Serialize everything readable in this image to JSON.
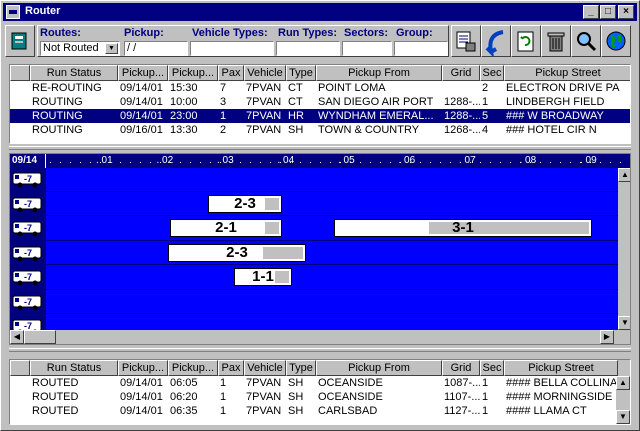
{
  "window": {
    "title": "Router"
  },
  "filters": {
    "routes_label": "Routes:",
    "routes_value": "Not Routed",
    "pickup_label": "Pickup:",
    "pickup_value": " / /",
    "vehicle_types_label": "Vehicle Types:",
    "vehicle_types_value": "",
    "run_types_label": "Run Types:",
    "run_types_value": "",
    "sectors_label": "Sectors:",
    "sectors_value": "",
    "group_label": "Group:",
    "group_value": ""
  },
  "columns": [
    "Run Status",
    "Pickup...",
    "Pickup...",
    "Pax",
    "Vehicle",
    "Type",
    "Pickup From",
    "Grid",
    "Sec",
    "Pickup Street"
  ],
  "top_grid": {
    "rows": [
      [
        "RE-ROUTING",
        "09/14/01",
        "15:30",
        "7",
        "7PVAN",
        "CT",
        "POINT LOMA",
        "",
        "2",
        "ELECTRON DRIVE PA"
      ],
      [
        "ROUTING",
        "09/14/01",
        "10:00",
        "3",
        "7PVAN",
        "CT",
        "SAN DIEGO AIR PORT",
        "1288-...",
        "1",
        "LINDBERGH FIELD"
      ],
      [
        "ROUTING",
        "09/14/01",
        "23:00",
        "1",
        "7PVAN",
        "HR",
        "WYNDHAM EMERAL...",
        "1288-...",
        "5",
        "### W BROADWAY"
      ],
      [
        "ROUTING",
        "09/16/01",
        "13:30",
        "2",
        "7PVAN",
        "SH",
        "TOWN & COUNTRY",
        "1268-...",
        "4",
        "### HOTEL CIR N"
      ]
    ],
    "selected_row": 2
  },
  "timeline": {
    "date": "09/14",
    "hours": [
      ". 01",
      ". 02",
      ". 03",
      ". 04",
      ". 05",
      ". 06",
      ". 07",
      ". 08",
      ". 09"
    ],
    "vehicle_label": "7",
    "runs": [
      {
        "label": "2-3"
      },
      {
        "label": "2-1"
      },
      {
        "label": "3-1"
      },
      {
        "label": "2-3"
      },
      {
        "label": "1-1"
      }
    ]
  },
  "bottom_grid": {
    "rows": [
      [
        "ROUTED",
        "09/14/01",
        "06:05",
        "1",
        "7PVAN",
        "SH",
        "OCEANSIDE",
        "1087-...",
        "1",
        "#### BELLA COLLINA S"
      ],
      [
        "ROUTED",
        "09/14/01",
        "06:20",
        "1",
        "7PVAN",
        "SH",
        "OCEANSIDE",
        "1107-...",
        "1",
        "#### MORNINGSIDE D"
      ],
      [
        "ROUTED",
        "09/14/01",
        "06:35",
        "1",
        "7PVAN",
        "SH",
        "CARLSBAD",
        "1127-...",
        "1",
        "#### LLAMA CT"
      ]
    ]
  },
  "colors": {
    "title_bar": "#000080",
    "lane_bg": "#0000ff",
    "selection": "#000080"
  }
}
